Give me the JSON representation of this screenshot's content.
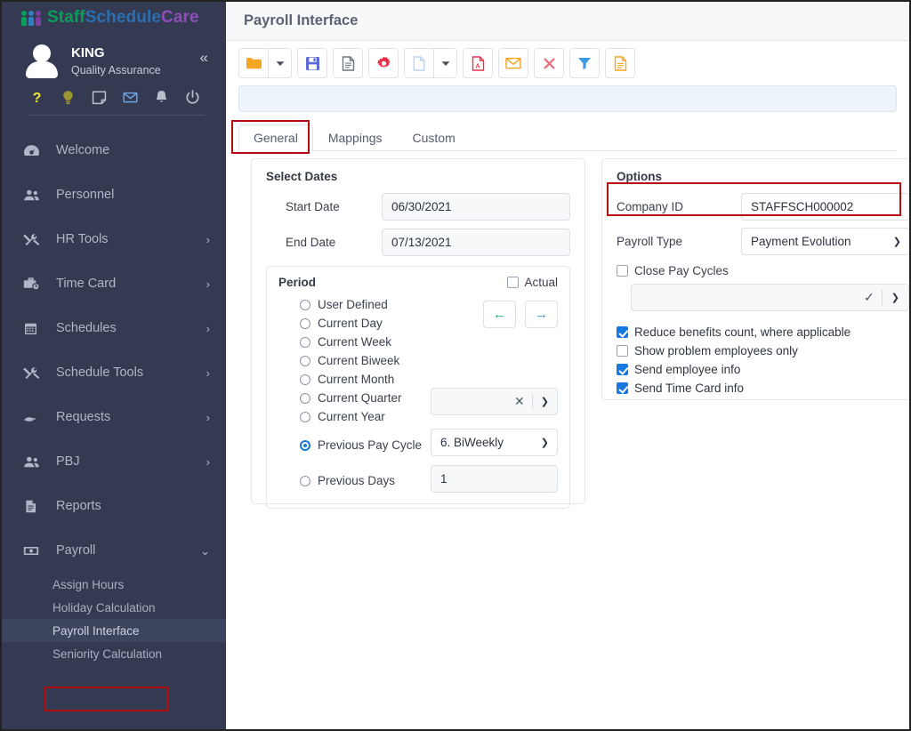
{
  "brand": {
    "name_part1": "Staff",
    "name_part2": "Schedule",
    "name_part3": "Care",
    "color1": "#0a9d5c",
    "color2": "#2a6fb0",
    "color3": "#8e4fb8"
  },
  "user": {
    "name": "KING",
    "role": "Quality Assurance",
    "collapse_icon": "«",
    "quick_icons": [
      {
        "name": "help-icon",
        "label": "?"
      },
      {
        "name": "lightbulb-icon",
        "label": "Tips"
      },
      {
        "name": "note-icon",
        "label": "Notes"
      },
      {
        "name": "mail-icon",
        "label": "Messages"
      },
      {
        "name": "bell-icon",
        "label": "Notifications"
      },
      {
        "name": "power-icon",
        "label": "Log out"
      }
    ]
  },
  "sidebar": {
    "items": [
      {
        "label": "Welcome",
        "icon": "dashboard-icon",
        "caret": ""
      },
      {
        "label": "Personnel",
        "icon": "people-icon",
        "caret": ""
      },
      {
        "label": "HR Tools",
        "icon": "tools-icon",
        "caret": "›"
      },
      {
        "label": "Time Card",
        "icon": "briefcase-clock-icon",
        "caret": "›"
      },
      {
        "label": "Schedules",
        "icon": "calendar-icon",
        "caret": "›"
      },
      {
        "label": "Schedule Tools",
        "icon": "tools-icon",
        "caret": "›"
      },
      {
        "label": "Requests",
        "icon": "hand-icon",
        "caret": "›"
      },
      {
        "label": "PBJ",
        "icon": "people-icon",
        "caret": "›"
      },
      {
        "label": "Reports",
        "icon": "report-icon",
        "caret": ""
      },
      {
        "label": "Payroll",
        "icon": "money-icon",
        "caret": "⌄"
      }
    ],
    "payroll_submenu": [
      {
        "label": "Assign Hours",
        "active": false
      },
      {
        "label": "Holiday Calculation",
        "active": false
      },
      {
        "label": "Payroll Interface",
        "active": true
      },
      {
        "label": "Seniority Calculation",
        "active": false
      }
    ]
  },
  "header": {
    "title": "Payroll Interface"
  },
  "toolbar": {
    "buttons": [
      {
        "name": "open-folder-button",
        "icon": "folder-icon",
        "color": "#f5a623"
      },
      {
        "name": "open-folder-dropdown",
        "icon": "caret-down-icon",
        "color": "#4a4f57"
      },
      {
        "name": "save-button",
        "icon": "save-disk-icon",
        "color": "#5b6bd6"
      },
      {
        "name": "document-button",
        "icon": "document-icon",
        "color": "#6d7480"
      },
      {
        "name": "settings-button",
        "icon": "gear-icon",
        "color": "#e8344a"
      },
      {
        "name": "new-document-button",
        "icon": "blank-page-icon",
        "color": "#b8d4f0"
      },
      {
        "name": "new-document-dropdown",
        "icon": "caret-down-icon",
        "color": "#4a4f57"
      },
      {
        "name": "export-pdf-button",
        "icon": "pdf-icon",
        "color": "#e8344a"
      },
      {
        "name": "email-button",
        "icon": "envelope-icon",
        "color": "#f5a623"
      },
      {
        "name": "delete-button",
        "icon": "close-x-icon",
        "color": "#ef6a7d"
      },
      {
        "name": "filter-button",
        "icon": "funnel-icon",
        "color": "#3b9ae8"
      },
      {
        "name": "report-button",
        "icon": "report-page-icon",
        "color": "#f5a623"
      }
    ]
  },
  "tabs": [
    {
      "label": "General",
      "active": true
    },
    {
      "label": "Mappings",
      "active": false
    },
    {
      "label": "Custom",
      "active": false
    }
  ],
  "select_dates": {
    "title": "Select Dates",
    "start_date_label": "Start Date",
    "start_date_value": "06/30/2021",
    "end_date_label": "End Date",
    "end_date_value": "07/13/2021"
  },
  "period": {
    "title": "Period",
    "actual_label": "Actual",
    "actual_checked": false,
    "options": [
      {
        "label": "User Defined",
        "selected": false
      },
      {
        "label": "Current Day",
        "selected": false
      },
      {
        "label": "Current Week",
        "selected": false
      },
      {
        "label": "Current Biweek",
        "selected": false
      },
      {
        "label": "Current Month",
        "selected": false
      },
      {
        "label": "Current Quarter",
        "selected": false
      },
      {
        "label": "Current Year",
        "selected": false
      },
      {
        "label": "Previous Pay Cycle",
        "selected": true
      },
      {
        "label": "Previous Days",
        "selected": false
      }
    ],
    "nav_prev_icon": "←",
    "nav_next_icon": "→",
    "quarter_select_value": "",
    "pay_cycle_value": "6. BiWeekly",
    "previous_days_value": "1"
  },
  "options": {
    "title": "Options",
    "company_id_label": "Company ID",
    "company_id_value": "STAFFSCH000002",
    "payroll_type_label": "Payroll Type",
    "payroll_type_value": "Payment Evolution",
    "close_pay_cycles_label": "Close Pay Cycles",
    "close_pay_cycles_checked": false,
    "pay_cycle_select_value": "",
    "checkboxes": [
      {
        "label": "Reduce benefits count, where applicable",
        "checked": true
      },
      {
        "label": "Show problem employees only",
        "checked": false
      },
      {
        "label": "Send employee info",
        "checked": true
      },
      {
        "label": "Send Time Card info",
        "checked": true
      }
    ]
  },
  "highlights": {
    "color": "#b10f0f",
    "regions": [
      "sidebar-payroll-interface",
      "tab-general",
      "options-company-id"
    ]
  }
}
